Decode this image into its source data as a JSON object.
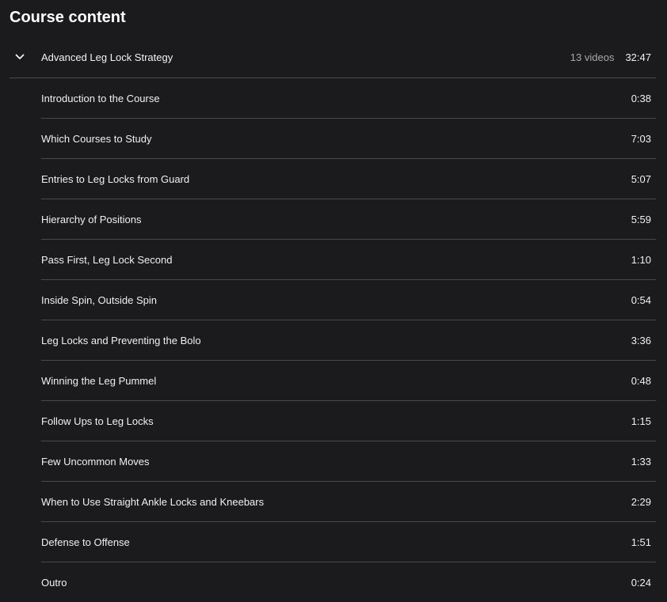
{
  "page": {
    "title": "Course content"
  },
  "section": {
    "title": "Advanced Leg Lock Strategy",
    "video_count": "13 videos",
    "duration": "32:47",
    "expanded_icon": "chevron-down-icon"
  },
  "lessons": [
    {
      "title": "Introduction to the Course",
      "duration": "0:38"
    },
    {
      "title": "Which Courses to Study",
      "duration": "7:03"
    },
    {
      "title": "Entries to Leg Locks from Guard",
      "duration": "5:07"
    },
    {
      "title": "Hierarchy of Positions",
      "duration": "5:59"
    },
    {
      "title": "Pass First, Leg Lock Second",
      "duration": "1:10"
    },
    {
      "title": "Inside Spin, Outside Spin",
      "duration": "0:54"
    },
    {
      "title": "Leg Locks and Preventing the Bolo",
      "duration": "3:36"
    },
    {
      "title": "Winning the Leg Pummel",
      "duration": "0:48"
    },
    {
      "title": "Follow Ups to Leg Locks",
      "duration": "1:15"
    },
    {
      "title": "Few Uncommon Moves",
      "duration": "1:33"
    },
    {
      "title": "When to Use Straight Ankle Locks and Kneebars",
      "duration": "2:29"
    },
    {
      "title": "Defense to Offense",
      "duration": "1:51"
    },
    {
      "title": "Outro",
      "duration": "0:24"
    }
  ],
  "colors": {
    "background": "#1b1b1d",
    "divider": "#4a4a4d",
    "text": "#f0f0f0",
    "muted": "#a8a8ac"
  }
}
